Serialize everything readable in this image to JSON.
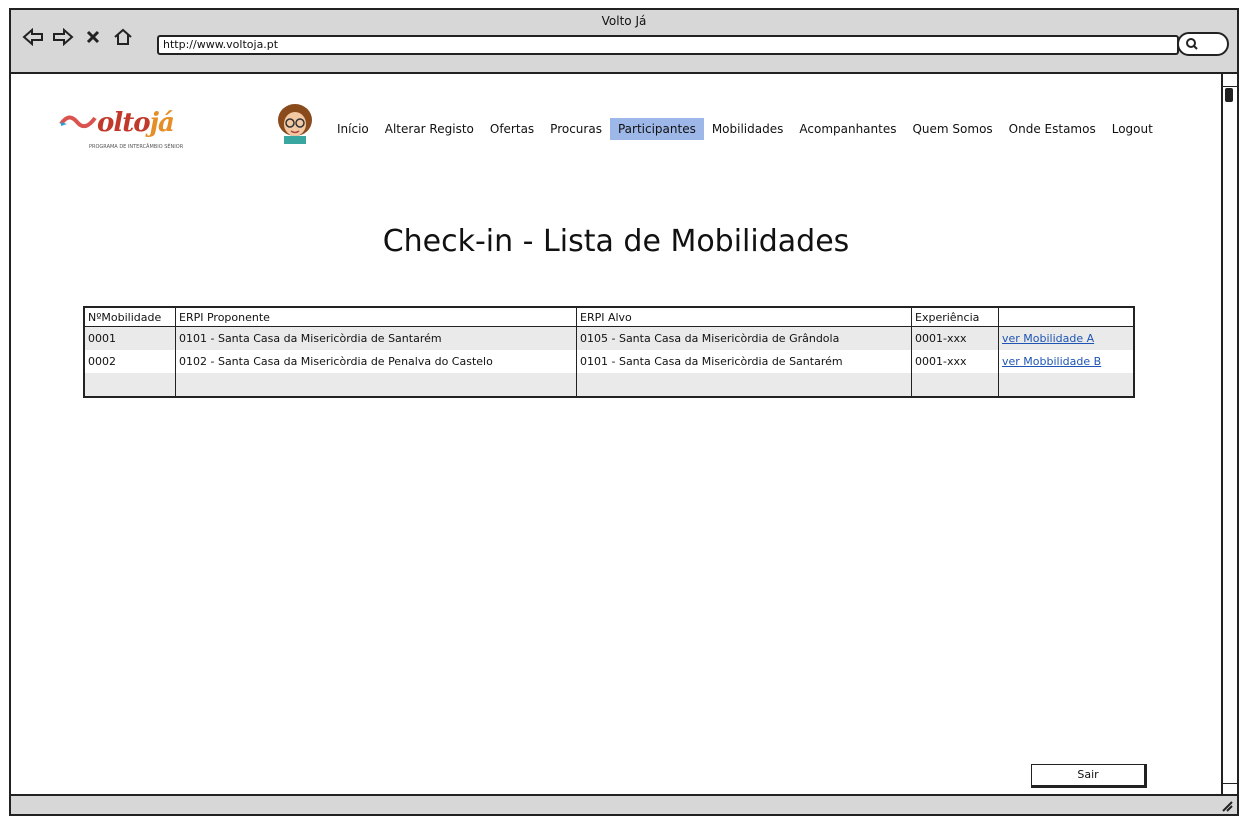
{
  "window": {
    "title": "Volto Já"
  },
  "browser": {
    "url": "http://www.voltoja.pt"
  },
  "brand": {
    "name": "Voltojá",
    "tagline": "PROGRAMA DE INTERCÂMBIO SÉNIOR"
  },
  "menu": {
    "items": [
      {
        "label": "Início"
      },
      {
        "label": "Alterar Registo"
      },
      {
        "label": "Ofertas"
      },
      {
        "label": "Procuras"
      },
      {
        "label": "Participantes",
        "active": true
      },
      {
        "label": "Mobilidades"
      },
      {
        "label": "Acompanhantes"
      },
      {
        "label": "Quem Somos"
      },
      {
        "label": "Onde Estamos"
      },
      {
        "label": "Logout"
      }
    ]
  },
  "page": {
    "heading": "Check-in - Lista de Mobilidades"
  },
  "table": {
    "headers": [
      "NºMobilidade",
      "ERPI Proponente",
      "ERPI Alvo",
      "Experiência",
      ""
    ],
    "rows": [
      {
        "num": "0001",
        "proponente": "0101 - Santa Casa da Misericòrdia de Santarém",
        "alvo": "0105 -  Santa Casa da Misericòrdia de Grândola",
        "experiencia": "0001-xxx",
        "link": "ver Mobilidade A"
      },
      {
        "num": "0002",
        "proponente": "0102 - Santa Casa da Misericòrdia de Penalva do Castelo",
        "alvo": "0101 - Santa Casa da Misericòrdia de Santarém",
        "experiencia": "0001-xxx",
        "link": "ver Mobbilidade B"
      }
    ]
  },
  "footer": {
    "exit_label": "Sair"
  },
  "colors": {
    "active_menu": "#9db8e8",
    "link": "#1e55b4",
    "chrome": "#d7d7d7"
  }
}
